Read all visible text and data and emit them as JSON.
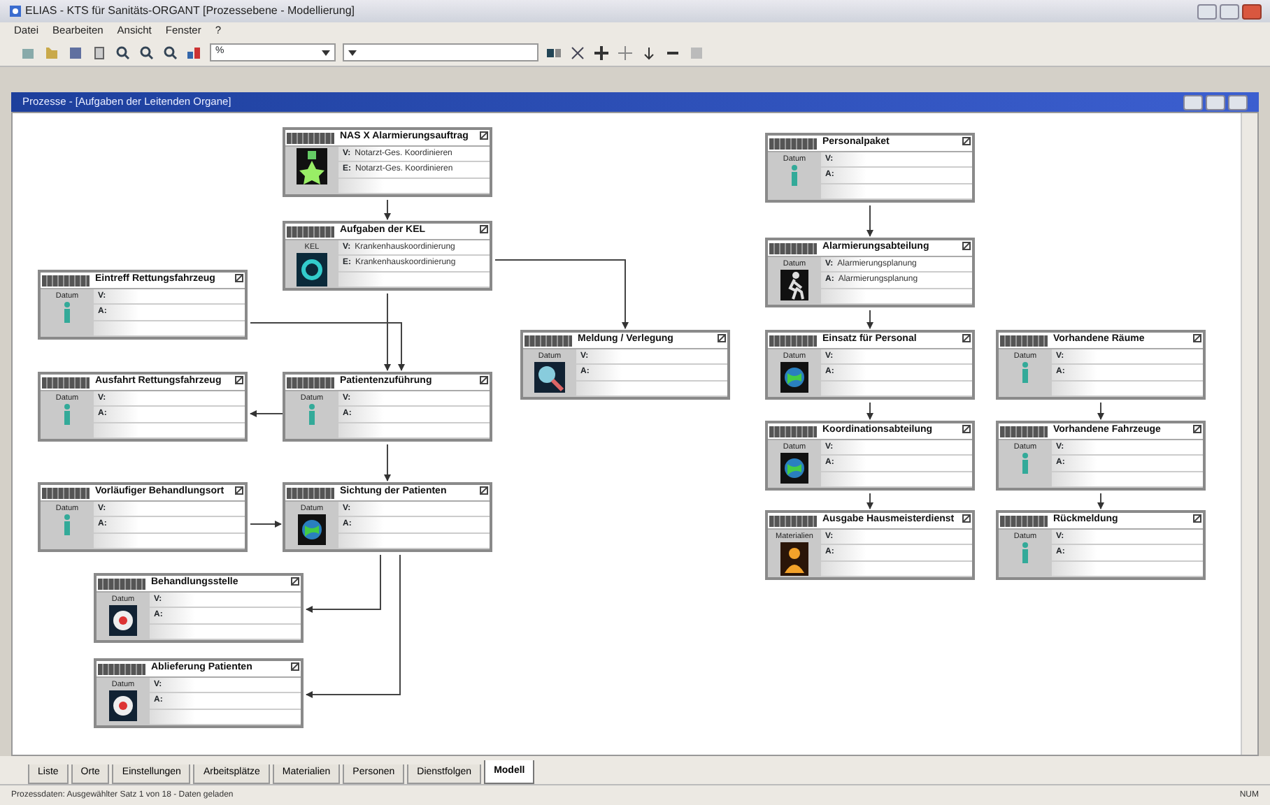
{
  "window": {
    "title": "ELIAS - KTS für Sanitäts-ORGANT [Prozessebene - Modellierung]"
  },
  "menu": [
    "Datei",
    "Bearbeiten",
    "Ansicht",
    "Fenster",
    "?"
  ],
  "toolbar": {
    "zoom_field": {
      "value": "%"
    }
  },
  "document": {
    "title": "Prozesse - [Aufgaben der Leitenden Organe]"
  },
  "nodes": [
    {
      "title": "NAS X Alarmierungsauftrag",
      "kind": "star",
      "rows": [
        {
          "tag": "V:",
          "text": "Notarzt-Ges. Koordinieren"
        },
        {
          "tag": "E:",
          "text": "Notarzt-Ges. Koordinieren"
        }
      ]
    },
    {
      "title": "Aufgaben der KEL",
      "label": "KEL",
      "kind": "ring",
      "rows": [
        {
          "tag": "V:",
          "text": "Krankenhauskoordinierung"
        },
        {
          "tag": "E:",
          "text": "Krankenhauskoordinierung"
        }
      ]
    },
    {
      "title": "Eintreff Rettungsfahrzeug",
      "label": "Datum",
      "kind": "figure",
      "rows": [
        {
          "tag": "V:"
        },
        {
          "tag": "A:"
        }
      ]
    },
    {
      "title": "Ausfahrt Rettungsfahrzeug",
      "label": "Datum",
      "kind": "figure",
      "rows": [
        {
          "tag": "V:"
        },
        {
          "tag": "A:"
        }
      ]
    },
    {
      "title": "Patientenzuführung",
      "label": "Datum",
      "kind": "figure",
      "rows": [
        {
          "tag": "V:"
        },
        {
          "tag": "A:"
        }
      ]
    },
    {
      "title": "Vorläufiger Behandlungsort",
      "label": "Datum",
      "kind": "figure",
      "rows": [
        {
          "tag": "V:"
        },
        {
          "tag": "A:"
        }
      ]
    },
    {
      "title": "Sichtung der Patienten",
      "label": "Datum",
      "kind": "globe",
      "rows": [
        {
          "tag": "V:"
        },
        {
          "tag": "A:"
        }
      ]
    },
    {
      "title": "Behandlungsstelle",
      "label": "Datum",
      "kind": "target",
      "rows": [
        {
          "tag": "V:"
        },
        {
          "tag": "A:"
        }
      ]
    },
    {
      "title": "Ablieferung Patienten",
      "label": "Datum",
      "kind": "target",
      "rows": [
        {
          "tag": "V:"
        },
        {
          "tag": "A:"
        }
      ]
    },
    {
      "title": "Meldung / Verlegung",
      "label": "Datum",
      "kind": "magnifier",
      "rows": [
        {
          "tag": "V:"
        },
        {
          "tag": "A:"
        }
      ]
    },
    {
      "title": "Personalpaket",
      "label": "Datum",
      "kind": "figure",
      "rows": [
        {
          "tag": "V:"
        },
        {
          "tag": "A:"
        }
      ]
    },
    {
      "title": "Alarmierungsabteilung",
      "label": "Datum",
      "kind": "runner",
      "rows": [
        {
          "tag": "V:",
          "text": "Alarmierungsplanung"
        },
        {
          "tag": "A:",
          "text": "Alarmierungsplanung"
        }
      ]
    },
    {
      "title": "Einsatz für Personal",
      "label": "Datum",
      "kind": "globe",
      "rows": [
        {
          "tag": "V:"
        },
        {
          "tag": "A:"
        }
      ]
    },
    {
      "title": "Vorhandene Räume",
      "label": "Datum",
      "kind": "figure",
      "rows": [
        {
          "tag": "V:"
        },
        {
          "tag": "A:"
        }
      ]
    },
    {
      "title": "Koordinationsabteilung",
      "label": "Datum",
      "kind": "globe",
      "rows": [
        {
          "tag": "V:"
        },
        {
          "tag": "A:"
        }
      ]
    },
    {
      "title": "Vorhandene Fahrzeuge",
      "label": "Datum",
      "kind": "figure",
      "rows": [
        {
          "tag": "V:"
        },
        {
          "tag": "A:"
        }
      ]
    },
    {
      "title": "Ausgabe Hausmeisterdienst",
      "label": "Materialien",
      "kind": "person",
      "rows": [
        {
          "tag": "V:"
        },
        {
          "tag": "A:"
        }
      ]
    },
    {
      "title": "Rückmeldung",
      "label": "Datum",
      "kind": "figure",
      "rows": [
        {
          "tag": "V:"
        },
        {
          "tag": "A:"
        }
      ]
    }
  ],
  "tabs": [
    {
      "label": "Liste",
      "selected": false
    },
    {
      "label": "Orte",
      "selected": false
    },
    {
      "label": "Einstellungen",
      "selected": false
    },
    {
      "label": "Arbeitsplätze",
      "selected": false
    },
    {
      "label": "Materialien",
      "selected": false
    },
    {
      "label": "Personen",
      "selected": false
    },
    {
      "label": "Dienstfolgen",
      "selected": false
    },
    {
      "label": "Modell",
      "selected": true
    }
  ],
  "status_bar": {
    "text": "Prozessdaten: Ausgewählter Satz 1 von 18 - Daten geladen",
    "mode": "NUM"
  }
}
